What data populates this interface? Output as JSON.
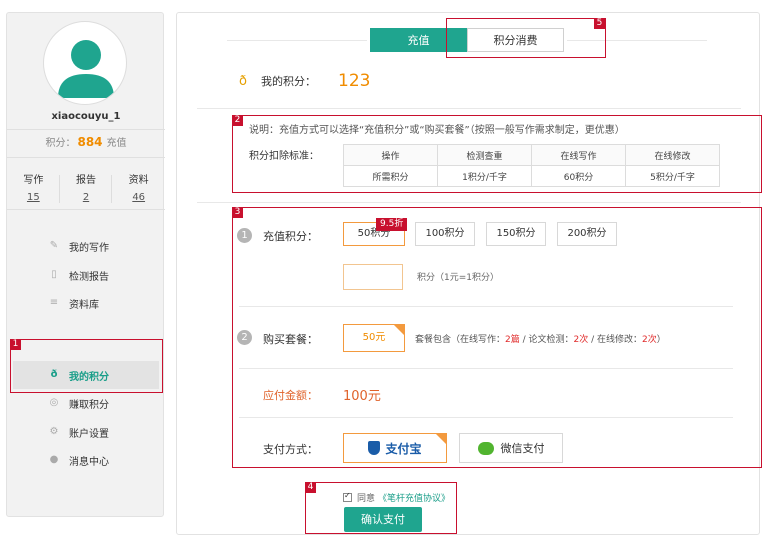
{
  "sidebar": {
    "username": "xiaocouyu_1",
    "points_label": "积分：",
    "points_value": "884",
    "recharge_label": "充值",
    "stats": [
      {
        "label": "写作",
        "value": "15"
      },
      {
        "label": "报告",
        "value": "2"
      },
      {
        "label": "资料",
        "value": "46"
      }
    ],
    "menu": [
      {
        "label": "我的写作",
        "icon": "pencil-icon"
      },
      {
        "label": "检测报告",
        "icon": "document-icon"
      },
      {
        "label": "资料库",
        "icon": "list-icon"
      },
      {
        "label": "我的积分",
        "icon": "money-bag-icon",
        "active": true
      },
      {
        "label": "赚取积分",
        "icon": "database-icon"
      },
      {
        "label": "账户设置",
        "icon": "gear-icon"
      },
      {
        "label": "消息中心",
        "icon": "chat-icon"
      }
    ]
  },
  "tabs": [
    {
      "label": "充值",
      "active": true
    },
    {
      "label": "积分消费",
      "active": false
    }
  ],
  "my_points": {
    "label": "我的积分：",
    "value": "123"
  },
  "note": "说明：充值方式可以选择“充值积分”或“购买套餐”（按照一般写作需求制定，更优惠）",
  "deduction": {
    "label": "积分扣除标准：",
    "headers": [
      "操作",
      "检测查重",
      "在线写作",
      "在线修改"
    ],
    "row": [
      "所需积分",
      "1积分/千字",
      "60积分",
      "5积分/千字"
    ]
  },
  "recharge": {
    "step": "1",
    "label": "充值积分：",
    "discount_badge": "9.5折",
    "options": [
      "50积分",
      "100积分",
      "150积分",
      "200积分"
    ],
    "input_hint": "积分（1元=1积分）"
  },
  "package": {
    "step": "2",
    "label": "购买套餐：",
    "price": "50元",
    "desc_prefix": "套餐包含（在线写作：",
    "write_count": "2篇",
    "desc_mid1": " / 论文检测：",
    "check_count": "2次",
    "desc_mid2": " / 在线修改：",
    "edit_count": "2次",
    "desc_suffix": "）"
  },
  "payment": {
    "amount_label": "应付金额：",
    "amount": "100元",
    "method_label": "支付方式：",
    "alipay_label": "支付宝",
    "wechat_label": "微信支付"
  },
  "agreement": {
    "prefix": "同意",
    "link": "《笔杆充值协议》"
  },
  "confirm_label": "确认支付",
  "annotations": [
    "1",
    "2",
    "3",
    "4",
    "5"
  ],
  "colors": {
    "accent": "#1fa58f",
    "orange": "#f08c00",
    "annotation": "#c8102e"
  }
}
